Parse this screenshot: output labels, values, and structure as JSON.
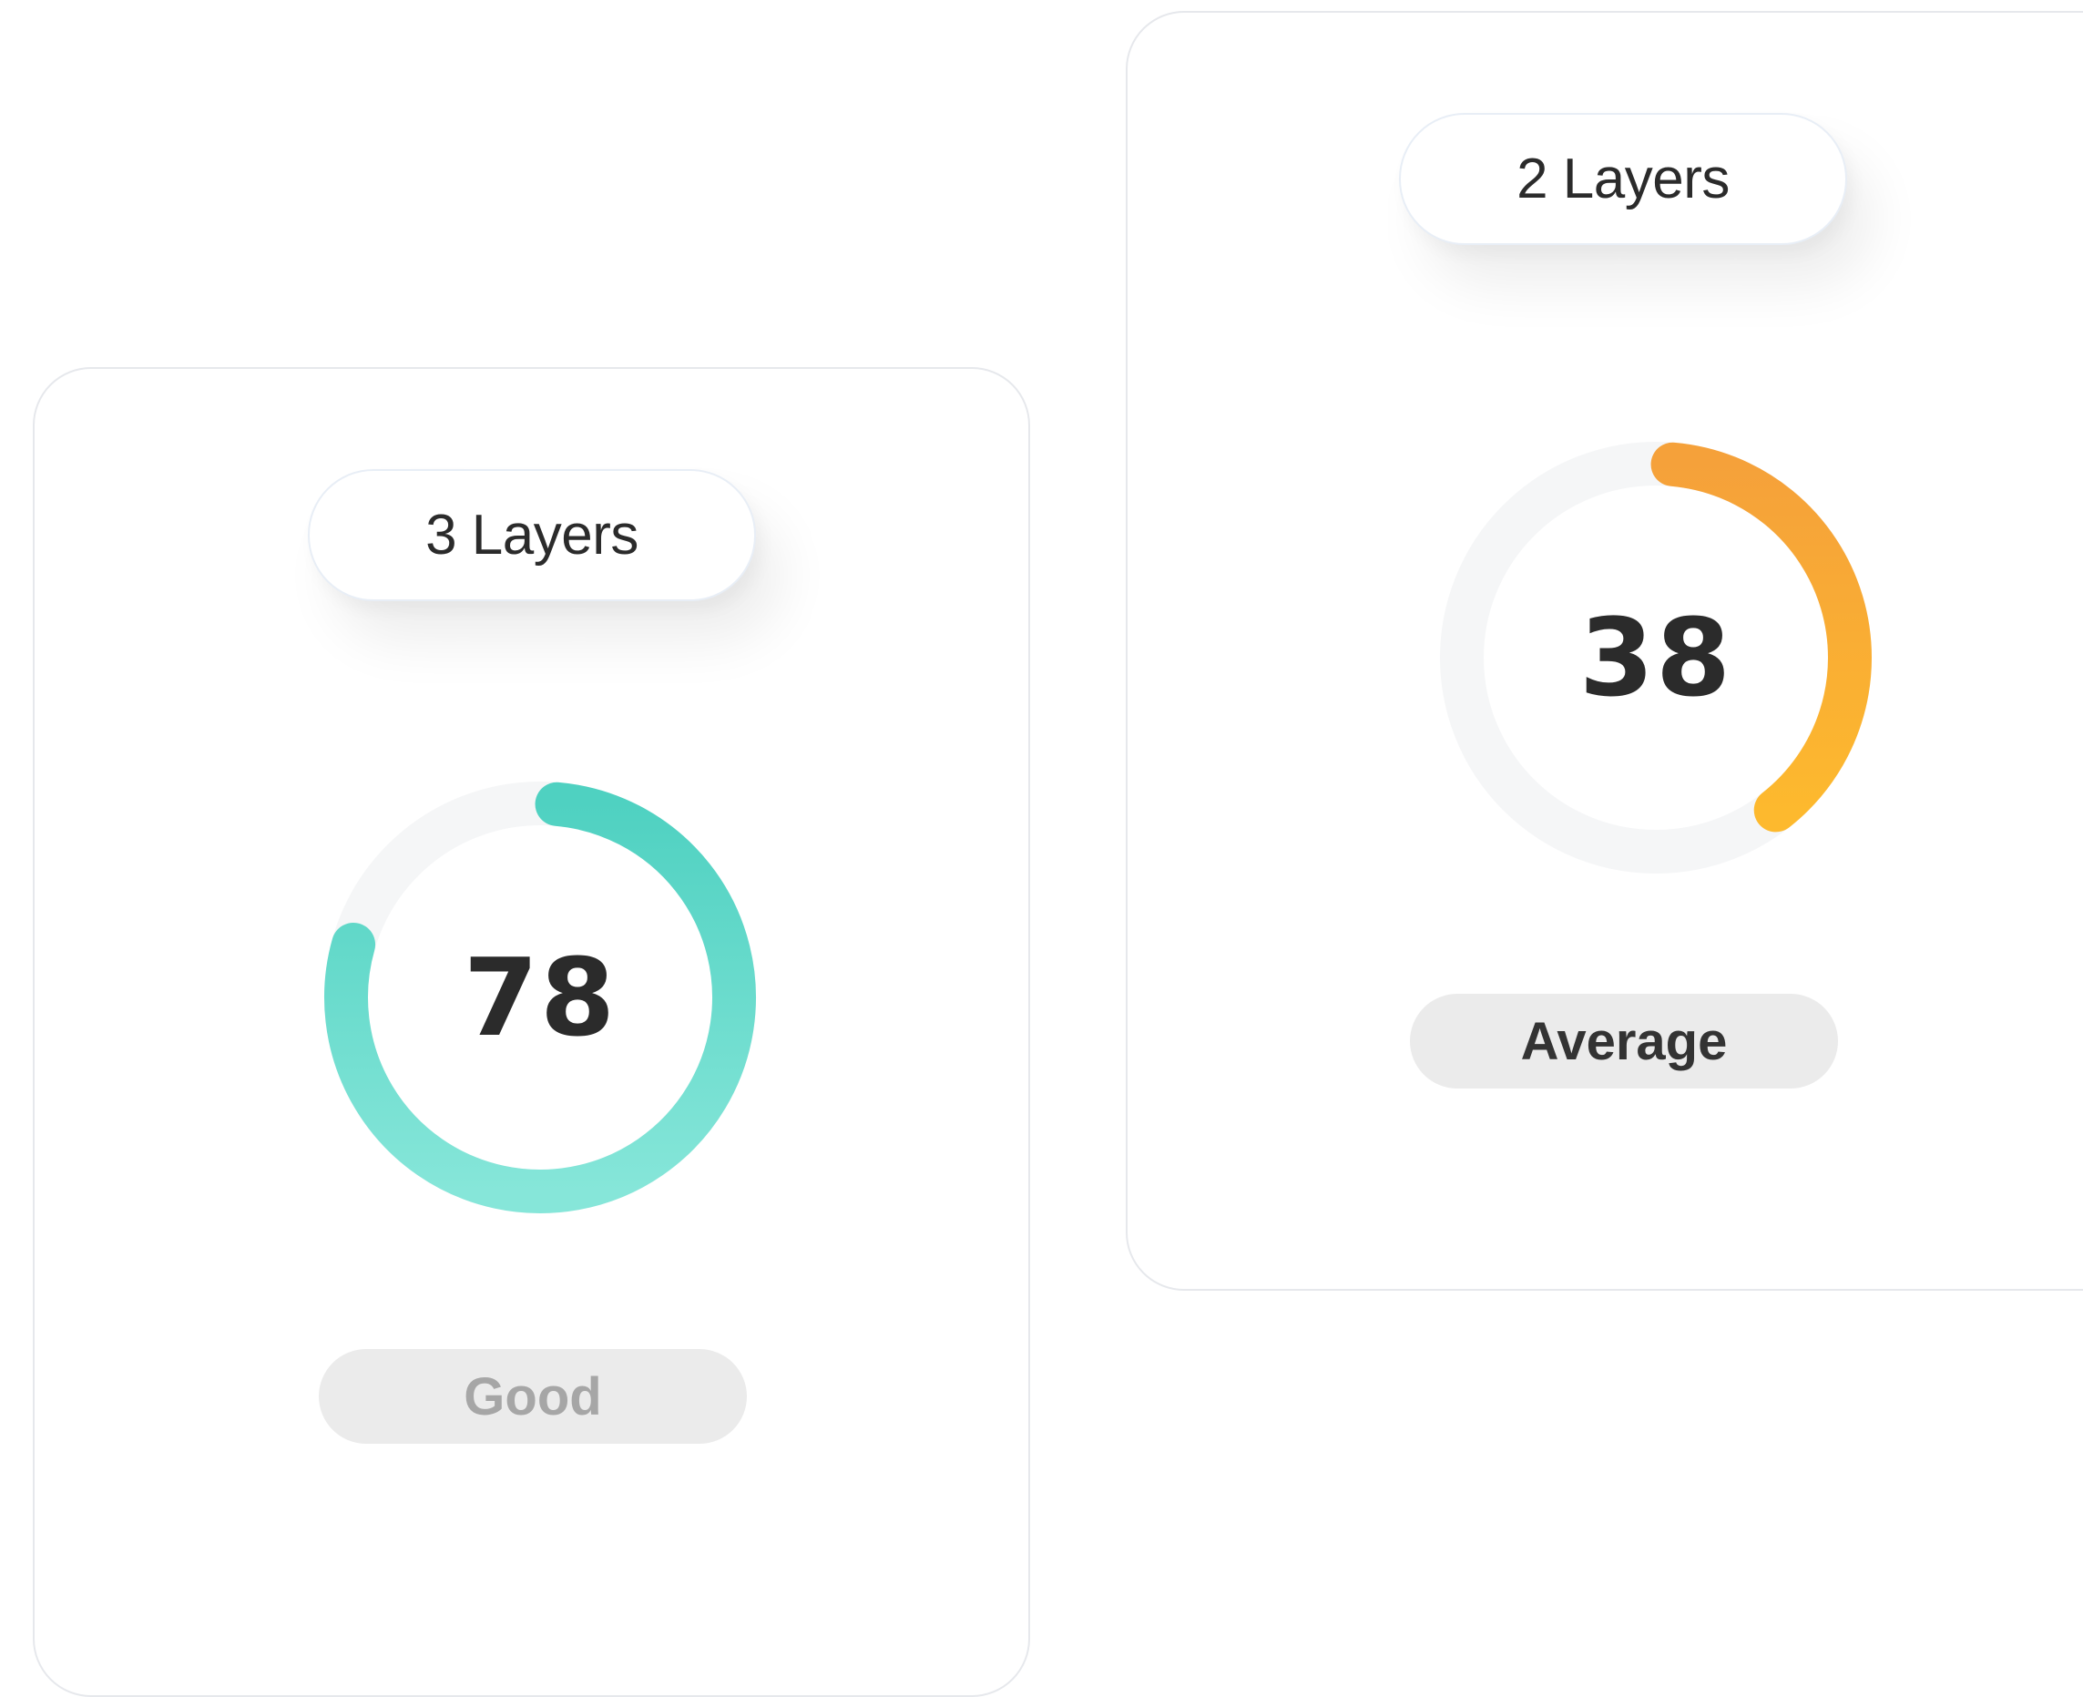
{
  "cards": [
    {
      "layers_label": "3 Layers",
      "score": "78",
      "score_fraction": 0.78,
      "status": "Good",
      "gauge_colors": [
        "#4fd1c1",
        "#86e6d9"
      ]
    },
    {
      "layers_label": "2 Layers",
      "score": "38",
      "score_fraction": 0.38,
      "status": "Average",
      "gauge_colors": [
        "#f5a13a",
        "#fdb92e"
      ]
    }
  ],
  "track_color": "#f5f6f7"
}
